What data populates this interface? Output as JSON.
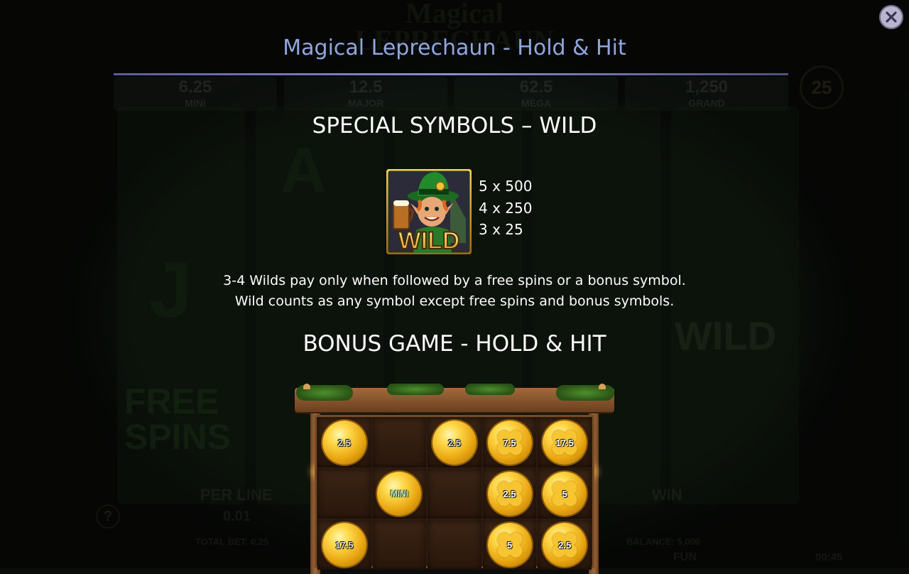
{
  "modal": {
    "title": "Magical Leprechaun - Hold & Hit"
  },
  "background": {
    "logo_line1": "Magical",
    "logo_line2": "LEPRECHAUN",
    "jackpots": [
      {
        "value": "6.25",
        "name": "MINI"
      },
      {
        "value": "12.5",
        "name": "MAJOR"
      },
      {
        "value": "62.5",
        "name": "MEGA"
      },
      {
        "value": "1,250",
        "name": "GRAND"
      }
    ],
    "lines_badge": "25",
    "per_line_label": "PER LINE",
    "per_line_value": "0.01",
    "win_label": "WIN",
    "total_bet": "TOTAL BET: 0.25",
    "balance": "BALANCE: 5,000",
    "mode": "FUN",
    "clock": "00:45",
    "help": "?"
  },
  "wild_section": {
    "heading": "SPECIAL SYMBOLS – WILD",
    "symbol_icon": "leprechaun-wild-icon",
    "symbol_text": "WILD",
    "pays": [
      "5 x 500",
      "4 x 250",
      "3 x 25"
    ],
    "description": [
      "3-4 Wilds pay only when followed by a free spins or a bonus symbol.",
      "Wild counts as any symbol except free spins and bonus symbols."
    ]
  },
  "bonus_section": {
    "heading": "BONUS GAME - HOLD & HIT",
    "grid": [
      [
        {
          "type": "coin",
          "label": "2.5"
        },
        {
          "type": "empty"
        },
        {
          "type": "coin",
          "label": "2.5"
        },
        {
          "type": "clover",
          "label": "7.5"
        },
        {
          "type": "clover",
          "label": "17.5"
        }
      ],
      [
        {
          "type": "empty"
        },
        {
          "type": "coin",
          "label": "MINI"
        },
        {
          "type": "empty"
        },
        {
          "type": "clover",
          "label": "2.5"
        },
        {
          "type": "clover",
          "label": "5"
        }
      ],
      [
        {
          "type": "coin",
          "label": "17.5"
        },
        {
          "type": "empty"
        },
        {
          "type": "empty"
        },
        {
          "type": "clover",
          "label": "5"
        },
        {
          "type": "clover",
          "label": "2.5"
        }
      ]
    ]
  },
  "colors": {
    "title": "#8fa6df",
    "coin_gold": "#e8a611",
    "board_wood": "#7a4a25"
  }
}
